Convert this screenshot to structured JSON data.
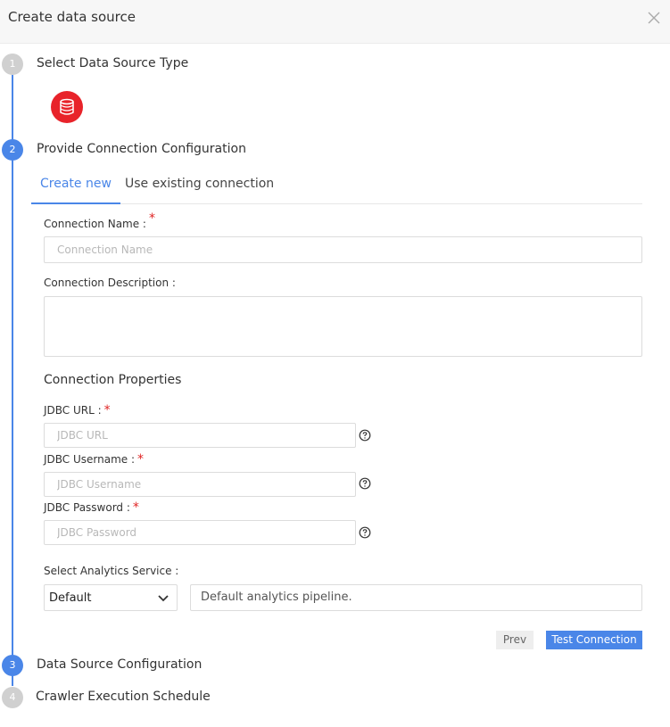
{
  "dialog": {
    "title": "Create data source"
  },
  "steps": [
    {
      "number": "1",
      "title": "Select Data Source Type"
    },
    {
      "number": "2",
      "title": "Provide Connection Configuration"
    },
    {
      "number": "3",
      "title": "Data Source Configuration"
    },
    {
      "number": "4",
      "title": "Crawler Execution Schedule"
    }
  ],
  "datasource": {
    "icon": "database-icon",
    "color": "#e8232a"
  },
  "tabs": {
    "create_new": "Create new",
    "use_existing": "Use existing connection"
  },
  "form": {
    "connection_name_label": "Connection Name :",
    "connection_name_placeholder": "Connection Name",
    "connection_description_label": "Connection Description :",
    "connection_properties_title": "Connection Properties",
    "jdbc_url_label": "JDBC URL :",
    "jdbc_url_placeholder": "JDBC URL",
    "jdbc_username_label": "JDBC Username :",
    "jdbc_username_placeholder": "JDBC Username",
    "jdbc_password_label": "JDBC Password :",
    "jdbc_password_placeholder": "JDBC Password",
    "required_mark": "*",
    "analytics_service_label": "Select Analytics Service :",
    "analytics_service_value": "Default",
    "analytics_service_description": "Default analytics pipeline."
  },
  "buttons": {
    "prev": "Prev",
    "test_connection": "Test Connection"
  },
  "colors": {
    "accent": "#4a86e8",
    "required": "#e02424",
    "inactive_step": "#d0d0d0"
  }
}
